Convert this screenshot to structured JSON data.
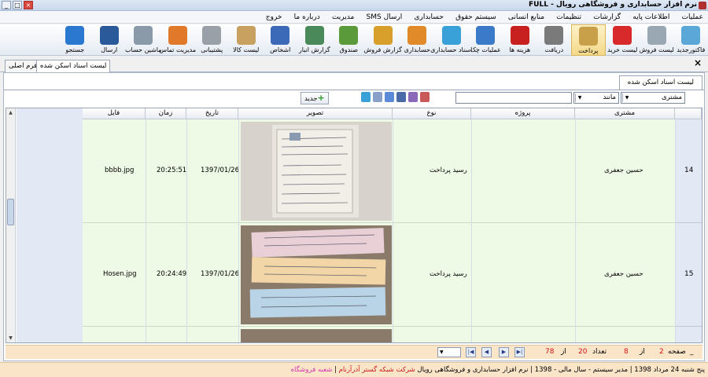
{
  "window": {
    "title": "نرم افزار حسابداری و فروشگاهی رویال - FULL"
  },
  "menu": [
    "عملیات",
    "اطلاعات پایه",
    "گزارشات",
    "تنظیمات",
    "منابع انسانی",
    "سیستم حقوق",
    "حسابداری",
    "ارسال SMS",
    "مدیریت",
    "درباره ما",
    "خروج"
  ],
  "toolbar": [
    {
      "label": "فاکتورجدید",
      "icon": "cart-new-icon",
      "color": "#5aa7d8"
    },
    {
      "label": "لیست فروش",
      "icon": "cash-register-icon",
      "color": "#9aa8b3"
    },
    {
      "label": "لیست خرید",
      "icon": "shopping-cart-icon",
      "color": "#d82a2a"
    },
    {
      "label": "پرداخت",
      "icon": "payment-icon",
      "color": "#c9a04a"
    },
    {
      "label": "دریافت",
      "icon": "safe-icon",
      "color": "#7a7a7a"
    },
    {
      "label": "هزینه ها",
      "icon": "dollar-icon",
      "color": "#c8201e"
    },
    {
      "label": "عملیات چک",
      "icon": "cheque-pen-icon",
      "color": "#3a7ac8"
    },
    {
      "label": "اسناد حسابداری",
      "icon": "document-check-icon",
      "color": "#3aa0d8"
    },
    {
      "label": "حسابداری",
      "icon": "books-icon",
      "color": "#e08a2a"
    },
    {
      "label": "گزارش فروش",
      "icon": "sales-chart-icon",
      "color": "#d8a02a"
    },
    {
      "label": "صندوق",
      "icon": "money-hand-icon",
      "color": "#5a9a3a"
    },
    {
      "label": "گزارش انبار",
      "icon": "warehouse-books-icon",
      "color": "#4a8a5a"
    },
    {
      "label": "اشخاص",
      "icon": "person-add-icon",
      "color": "#3a6ab8"
    },
    {
      "label": "لیست کالا",
      "icon": "boxes-icon",
      "color": "#c8a060"
    },
    {
      "label": "پشتیبانی",
      "icon": "support-coins-icon",
      "color": "#9aa0a8"
    },
    {
      "label": "مدیریت تماس",
      "icon": "phone-icon",
      "color": "#e07a2a"
    },
    {
      "label": "ماشین حساب",
      "icon": "calculator-icon",
      "color": "#8a9aa8"
    },
    {
      "label": "ارسال",
      "icon": "send-gear-icon",
      "color": "#2a5a9a"
    },
    {
      "label": "جستجو",
      "icon": "search-icon",
      "color": "#2a78d0"
    }
  ],
  "tabs": {
    "scanned": "لیست اسناد اسکن شده",
    "main": "فرم اصلی"
  },
  "panel_tab": "لیست اسناد اسکن شده",
  "filter": {
    "field": "مشتری",
    "operator": "مانند",
    "value": "",
    "new_button": "جدید"
  },
  "columns": {
    "customer": "مشتری",
    "project": "پروژه",
    "type": "نوع",
    "image": "تصویر",
    "date": "تاریخ",
    "time": "زمان",
    "file": "فایل"
  },
  "rows": [
    {
      "num": "14",
      "customer": "حسین جعفری",
      "project": "",
      "type": "رسید پرداخت",
      "date": "1397/01/26",
      "time": "20:25:51",
      "file": "bbbb.jpg"
    },
    {
      "num": "15",
      "customer": "حسین جعفری",
      "project": "",
      "type": "رسید پرداخت",
      "date": "1397/01/26",
      "time": "20:24:49",
      "file": "Hosen.jpg"
    }
  ],
  "pager": {
    "page_label": "صفحه",
    "page": "2",
    "of_label": "از",
    "total_pages": "8",
    "count_label": "تعداد",
    "count": "20",
    "of2_label": "از",
    "total": "78"
  },
  "status": {
    "date": "پنج شنبه 24 مرداد 1398",
    "user": "مدیر سیستم",
    "year": "سال مالی  -  1398",
    "company": "شرکت شبکه گستر آذرآرنام",
    "product": "نرم افزار حسابداری و فروشگاهی رویال",
    "branch": "شعبه فروشگاه"
  }
}
